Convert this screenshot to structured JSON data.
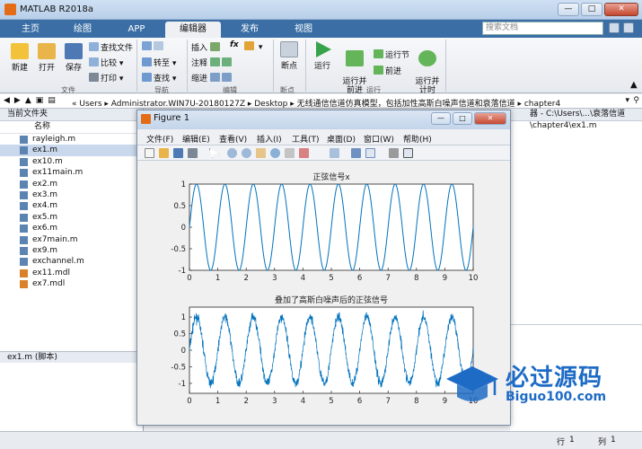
{
  "window": {
    "title": "MATLAB R2018a"
  },
  "tabs": [
    {
      "label": "主页",
      "active": false
    },
    {
      "label": "绘图",
      "active": false
    },
    {
      "label": "APP",
      "active": false
    },
    {
      "label": "编辑器",
      "active": true
    },
    {
      "label": "发布",
      "active": false
    },
    {
      "label": "视图",
      "active": false
    }
  ],
  "search": {
    "placeholder": "搜索文档"
  },
  "ribbon": {
    "file": {
      "new": "新建",
      "open": "打开",
      "save": "保存",
      "find_files": "查找文件",
      "compare": "比较",
      "print": "打印",
      "group": "文件"
    },
    "navigate": {
      "goto": "转至",
      "find": "查找",
      "group": "导航"
    },
    "edit": {
      "insert": "插入",
      "comment": "注释",
      "indent": "缩进",
      "fx": "fx",
      "group": "编辑"
    },
    "breakpoints": {
      "label": "断点",
      "group": "断点"
    },
    "run": {
      "run": "运行",
      "run_advance": "运行并\n前进",
      "run_section": "运行节",
      "advance": "前进",
      "run_time": "运行并\n计时",
      "group": "运行"
    }
  },
  "address": {
    "path": "«  Users  ▸  Administrator.WIN7U-20180127Z  ▸  Desktop  ▸  无线通信信道仿真模型，包括加性高斯白噪声信道和衰落信道  ▸  chapter4"
  },
  "left_panel": {
    "header": "当前文件夹",
    "column": "名称",
    "files": [
      {
        "name": "rayleigh.m",
        "selected": false
      },
      {
        "name": "ex1.m",
        "selected": true
      },
      {
        "name": "ex10.m",
        "selected": false
      },
      {
        "name": "ex11main.m",
        "selected": false
      },
      {
        "name": "ex2.m",
        "selected": false
      },
      {
        "name": "ex3.m",
        "selected": false
      },
      {
        "name": "ex4.m",
        "selected": false
      },
      {
        "name": "ex5.m",
        "selected": false
      },
      {
        "name": "ex6.m",
        "selected": false
      },
      {
        "name": "ex7main.m",
        "selected": false
      },
      {
        "name": "ex9.m",
        "selected": false
      },
      {
        "name": "exchannel.m",
        "selected": false
      },
      {
        "name": "ex11.mdl",
        "selected": false
      },
      {
        "name": "ex7.mdl",
        "selected": false
      }
    ],
    "detail": "ex1.m  (脚本)"
  },
  "right_panel": {
    "tab_text": "器 - C:\\Users\\...\\衰落信道\\chapter4\\ex1.m"
  },
  "status": {
    "row_label": "行",
    "row_value": "1",
    "col_label": "列",
    "col_value": "1"
  },
  "figure": {
    "title": "Figure 1",
    "menus": [
      "文件(F)",
      "编辑(E)",
      "查看(V)",
      "插入(I)",
      "工具(T)",
      "桌面(D)",
      "窗口(W)",
      "帮助(H)"
    ]
  },
  "watermark": {
    "main": "必过源码",
    "sub": "Biguo100.com"
  },
  "colors": {
    "line": "#0072bd",
    "tabbar": "#3a6ea5",
    "accent": "#e46c16"
  },
  "chart_data": [
    {
      "type": "line",
      "title": "正弦信号x",
      "xlim": [
        0,
        10
      ],
      "ylim": [
        -1,
        1
      ],
      "xticks": [
        "0",
        "1",
        "2",
        "3",
        "4",
        "5",
        "6",
        "7",
        "8",
        "9",
        "10"
      ],
      "yticks": [
        "-1",
        "-0.5",
        "0",
        "0.5",
        "1"
      ],
      "function": "sin",
      "frequency_hz": 1,
      "noise": 0
    },
    {
      "type": "line",
      "title": "叠加了高斯白噪声后的正弦信号",
      "xlim": [
        0,
        10
      ],
      "ylim": [
        -1.3,
        1.3
      ],
      "xticks": [
        "0",
        "1",
        "2",
        "3",
        "4",
        "5",
        "6",
        "7",
        "8",
        "9",
        "10"
      ],
      "yticks": [
        "-1",
        "-0.5",
        "0",
        "0.5",
        "1"
      ],
      "function": "sin",
      "frequency_hz": 1,
      "noise": 0.12
    }
  ]
}
